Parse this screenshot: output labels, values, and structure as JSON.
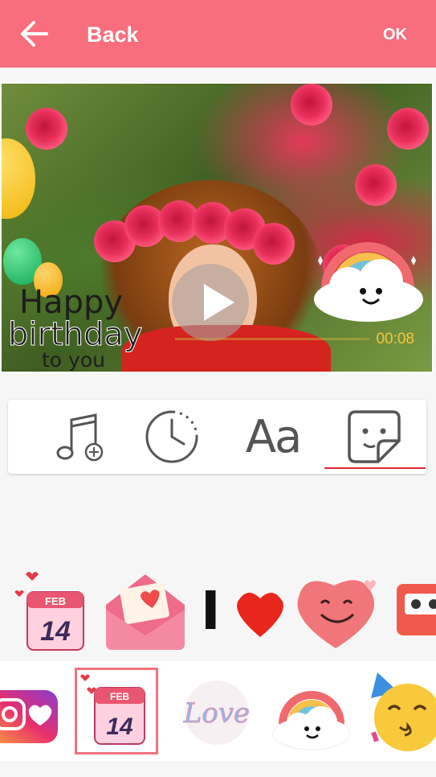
{
  "header": {
    "back_label": "Back",
    "ok_label": "OK",
    "background_color": "#f96e7c"
  },
  "preview": {
    "overlay_text_line1": "Happy",
    "overlay_text_line2": "birthday",
    "overlay_text_line3": "to you",
    "time": "00:08",
    "play_icon": "play-icon"
  },
  "toolbar": {
    "tools": [
      {
        "name": "music",
        "icon": "music-add-icon"
      },
      {
        "name": "duration",
        "icon": "clock-icon"
      },
      {
        "name": "text",
        "icon": "text-icon",
        "label": "Aa"
      },
      {
        "name": "sticker",
        "icon": "sticker-icon",
        "selected": true
      }
    ],
    "accent_color": "#e0262e"
  },
  "sticker_grid": [
    {
      "name": "feb14-calendar",
      "month": "FEB",
      "day": "14"
    },
    {
      "name": "love-letter-envelope"
    },
    {
      "name": "i-love",
      "text": "I"
    },
    {
      "name": "smiling-heart"
    },
    {
      "name": "cassette-tape"
    }
  ],
  "sticker_packs": [
    {
      "name": "instagram-heart"
    },
    {
      "name": "feb14-calendar",
      "month": "FEB",
      "day": "14",
      "selected": true
    },
    {
      "name": "love-lettering",
      "text": "Love"
    },
    {
      "name": "rainbow-cloud"
    },
    {
      "name": "party-face"
    }
  ]
}
